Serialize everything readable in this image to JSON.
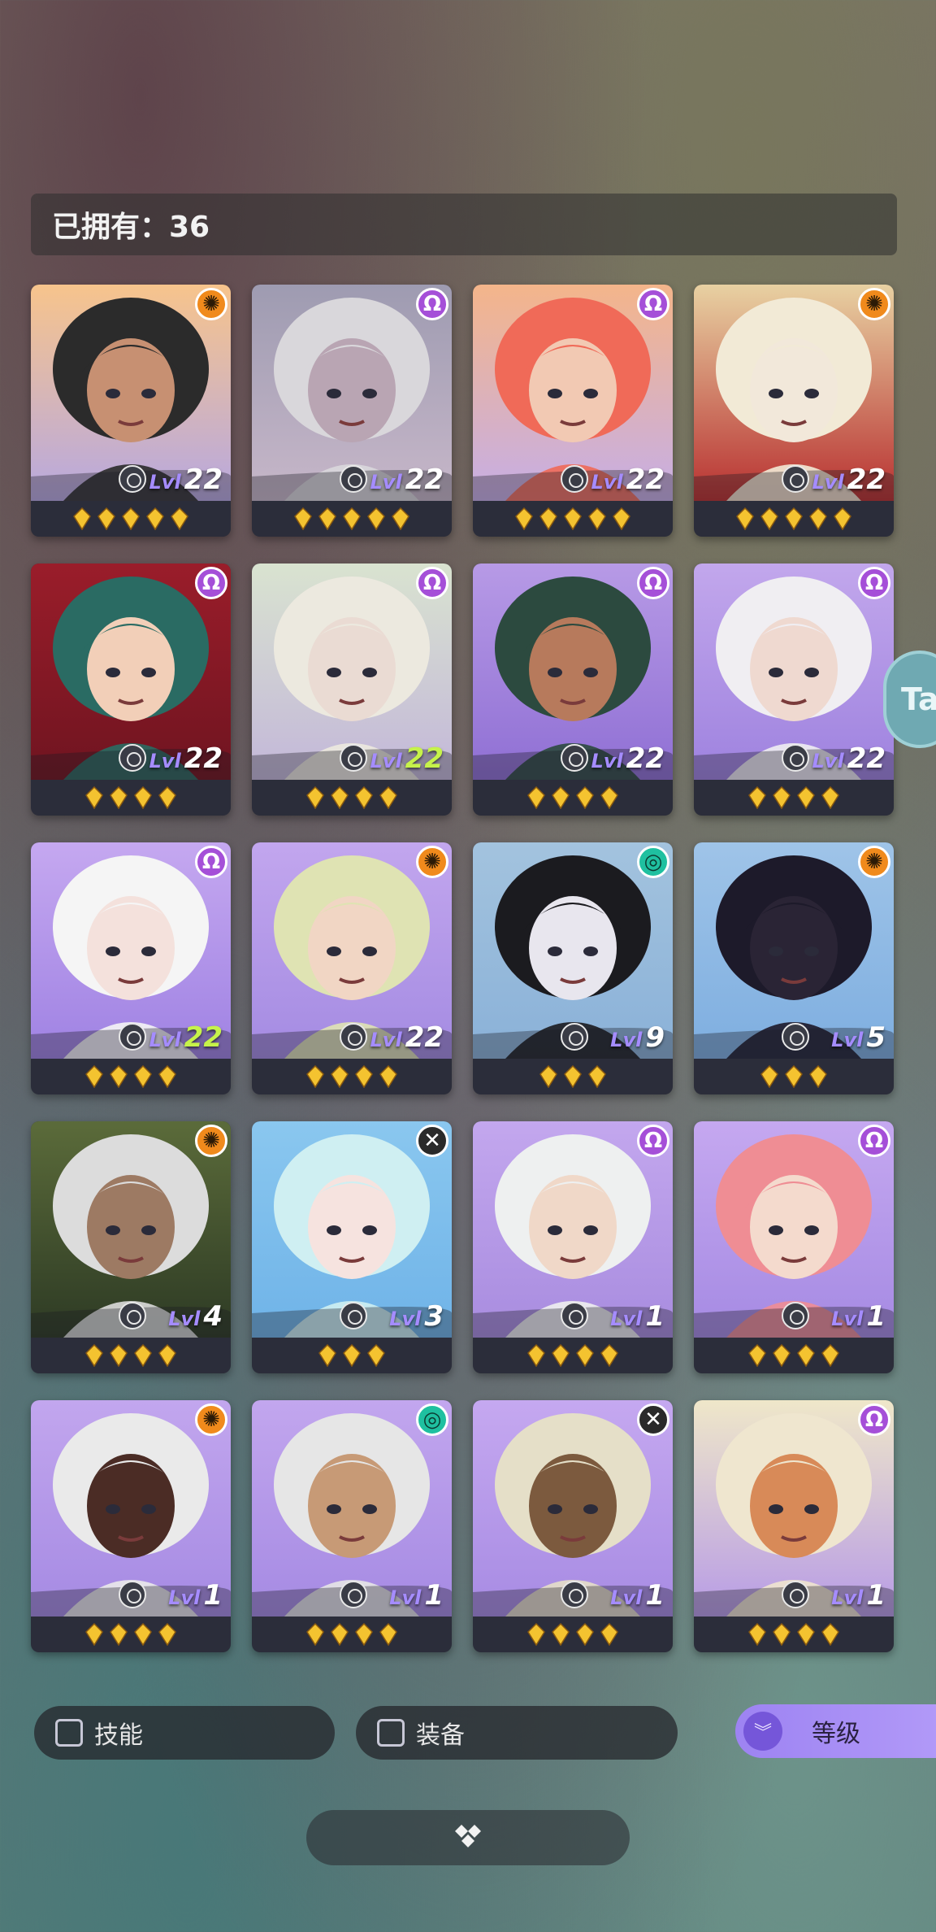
{
  "header": {
    "owned_label": "已拥有：36"
  },
  "cards": [
    {
      "faction": "sun",
      "level": "22",
      "stars": 5,
      "bg": [
        "#f7c48c",
        "#b7a8e0"
      ],
      "hair": "#2b2b2b",
      "skin": "#c79072"
    },
    {
      "faction": "mage",
      "level": "22",
      "stars": 5,
      "bg": [
        "#9e9bb1",
        "#c7b7c9"
      ],
      "hair": "#d9d7db",
      "skin": "#b9a5b3"
    },
    {
      "faction": "mage",
      "level": "22",
      "stars": 5,
      "bg": [
        "#f4b58a",
        "#c6aee6"
      ],
      "hair": "#f06a58",
      "skin": "#f2c9b3"
    },
    {
      "faction": "sun",
      "level": "22",
      "stars": 5,
      "bg": [
        "#e8d1a2",
        "#b83030"
      ],
      "hair": "#f2ead6",
      "skin": "#f2e8da"
    },
    {
      "faction": "mage",
      "level": "22",
      "stars": 4,
      "bg": [
        "#9a1d2a",
        "#6f1420"
      ],
      "hair": "#2a6b63",
      "skin": "#f2cfb8"
    },
    {
      "faction": "mage",
      "level": "22",
      "stars": 4,
      "bg": [
        "#d9e3d0",
        "#c3b7d9"
      ],
      "hair": "#ece9df",
      "skin": "#eadbd3"
    },
    {
      "faction": "mage",
      "level": "22",
      "stars": 4,
      "bg": [
        "#b79ae6",
        "#8f6fd4"
      ],
      "hair": "#2c4a3f",
      "skin": "#b77a5c"
    },
    {
      "faction": "mage",
      "level": "22",
      "stars": 4,
      "bg": [
        "#c2a7ec",
        "#9e82df"
      ],
      "hair": "#f0eef2",
      "skin": "#efd9d0"
    },
    {
      "faction": "mage",
      "level": "22",
      "stars": 4,
      "bg": [
        "#c5a8f0",
        "#9f82e3"
      ],
      "hair": "#f5f5f5",
      "skin": "#f4e1dc"
    },
    {
      "faction": "sun",
      "level": "22",
      "stars": 4,
      "bg": [
        "#c2a6ee",
        "#a48be2"
      ],
      "hair": "#dfe3b3",
      "skin": "#f1d6c4"
    },
    {
      "faction": "wind",
      "level": "9",
      "stars": 3,
      "bg": [
        "#a3c3de",
        "#8ab1d8"
      ],
      "hair": "#1b1b1f",
      "skin": "#e8e6ee"
    },
    {
      "faction": "sun",
      "level": "5",
      "stars": 3,
      "bg": [
        "#9fc4e8",
        "#7eaee0"
      ],
      "hair": "#1d1a2a",
      "skin": "#2a2435"
    },
    {
      "faction": "sun",
      "level": "4",
      "stars": 4,
      "bg": [
        "#5b6b3a",
        "#2d3a24"
      ],
      "hair": "#dcdcdc",
      "skin": "#9d7a63"
    },
    {
      "faction": "cross",
      "level": "3",
      "stars": 3,
      "bg": [
        "#8ac7ef",
        "#6fb3e8"
      ],
      "hair": "#cfeff2",
      "skin": "#f6e3df"
    },
    {
      "faction": "mage",
      "level": "1",
      "stars": 4,
      "bg": [
        "#c3a7ee",
        "#a88cdf"
      ],
      "hair": "#eef0f0",
      "skin": "#f0d8c8"
    },
    {
      "faction": "mage",
      "level": "1",
      "stars": 4,
      "bg": [
        "#c5a8f0",
        "#a58ae3"
      ],
      "hair": "#ef8d94",
      "skin": "#f4dacd"
    },
    {
      "faction": "sun",
      "level": "1",
      "stars": 4,
      "bg": [
        "#c2a6ee",
        "#a58ae3"
      ],
      "hair": "#eaeaea",
      "skin": "#4b2c25"
    },
    {
      "faction": "wind",
      "level": "1",
      "stars": 4,
      "bg": [
        "#c2a6ee",
        "#a58ae3"
      ],
      "hair": "#e6e6e6",
      "skin": "#c79a76"
    },
    {
      "faction": "cross",
      "level": "1",
      "stars": 4,
      "bg": [
        "#c5a8f0",
        "#a78be3"
      ],
      "hair": "#e5dfc8",
      "skin": "#7c5a3e"
    },
    {
      "faction": "mage",
      "level": "1",
      "stars": 4,
      "bg": [
        "#efe7c9",
        "#b79be6"
      ],
      "hair": "#efe6cf",
      "skin": "#d88a58"
    }
  ],
  "level_label": "Lvl",
  "filters": {
    "skill_label": "技能",
    "equip_label": "装备",
    "sort_label": "等级"
  },
  "side_tab_label": "Ta",
  "colors": {
    "faction_sun": "#f08a1c",
    "faction_mage": "#a54fd8",
    "faction_wind": "#1fc0a0",
    "star": "#f4c330",
    "sort_accent": "#9d83f2"
  }
}
